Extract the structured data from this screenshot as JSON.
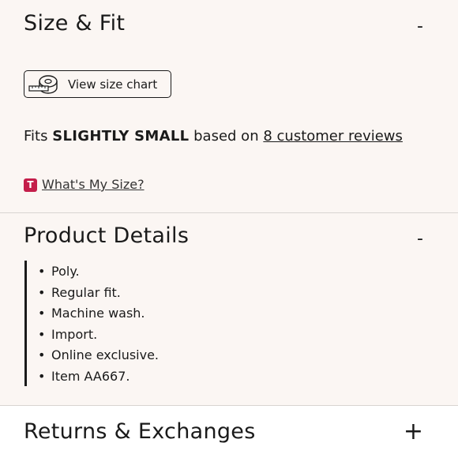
{
  "size_fit": {
    "heading": "Size & Fit",
    "toggle": "-",
    "size_chart_button": "View size chart",
    "fits_prefix": "Fits",
    "fits_value": "SLIGHTLY SMALL",
    "fits_middle": "based on",
    "reviews_link": "8 customer reviews",
    "badge_letter": "T",
    "whats_my_size": "What's My Size?",
    "icons": [
      "tape-measure-icon",
      "t-badge-icon"
    ]
  },
  "product_details": {
    "heading": "Product Details",
    "toggle": "-",
    "items": [
      "Poly.",
      "Regular fit.",
      "Machine wash.",
      "Import.",
      "Online exclusive.",
      "Item AA667."
    ]
  },
  "returns": {
    "heading": "Returns & Exchanges",
    "toggle": "+"
  },
  "colors": {
    "section_bg": "#fbf6f3",
    "badge": "#c41e4a",
    "text": "#1a1a1a"
  }
}
